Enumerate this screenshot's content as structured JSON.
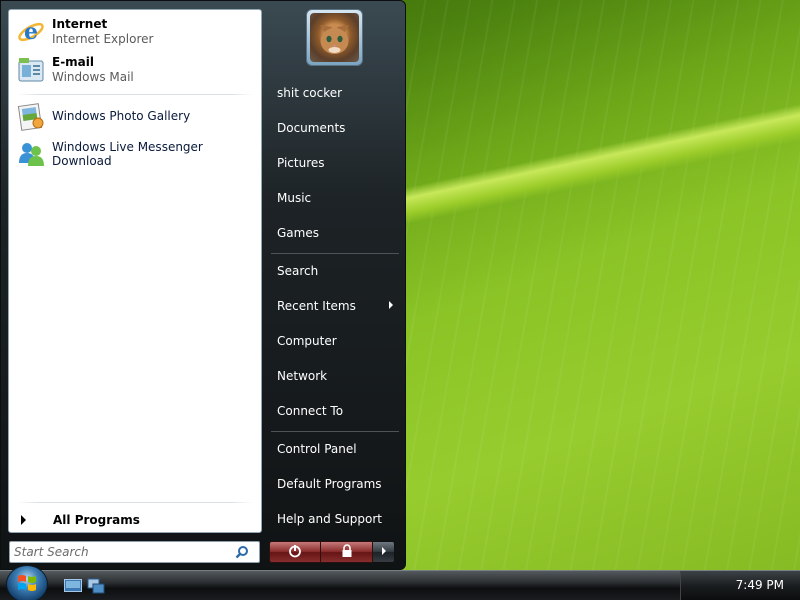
{
  "start_menu": {
    "pinned": [
      {
        "title": "Internet",
        "subtitle": "Internet Explorer",
        "icon": "internet-explorer-icon"
      },
      {
        "title": "E-mail",
        "subtitle": "Windows Mail",
        "icon": "windows-mail-icon"
      }
    ],
    "recent": [
      {
        "label": "Windows Photo Gallery",
        "icon": "photo-gallery-icon"
      },
      {
        "label": "Windows Live Messenger Download",
        "icon": "messenger-icon"
      }
    ],
    "all_programs_label": "All Programs",
    "search_placeholder": "Start Search",
    "right_items": [
      {
        "label": "shit cocker"
      },
      {
        "label": "Documents"
      },
      {
        "label": "Pictures"
      },
      {
        "label": "Music"
      },
      {
        "label": "Games"
      },
      {
        "label": "Search"
      },
      {
        "label": "Recent Items"
      },
      {
        "label": "Computer"
      },
      {
        "label": "Network"
      },
      {
        "label": "Connect To"
      },
      {
        "label": "Control Panel"
      },
      {
        "label": "Default Programs"
      },
      {
        "label": "Help and Support"
      }
    ]
  },
  "taskbar": {
    "clock": "7:49 PM"
  },
  "colors": {
    "power_button": "#8a2d2d",
    "menu_dark": "#1d2326",
    "wallpaper_green": "#8bc426"
  }
}
